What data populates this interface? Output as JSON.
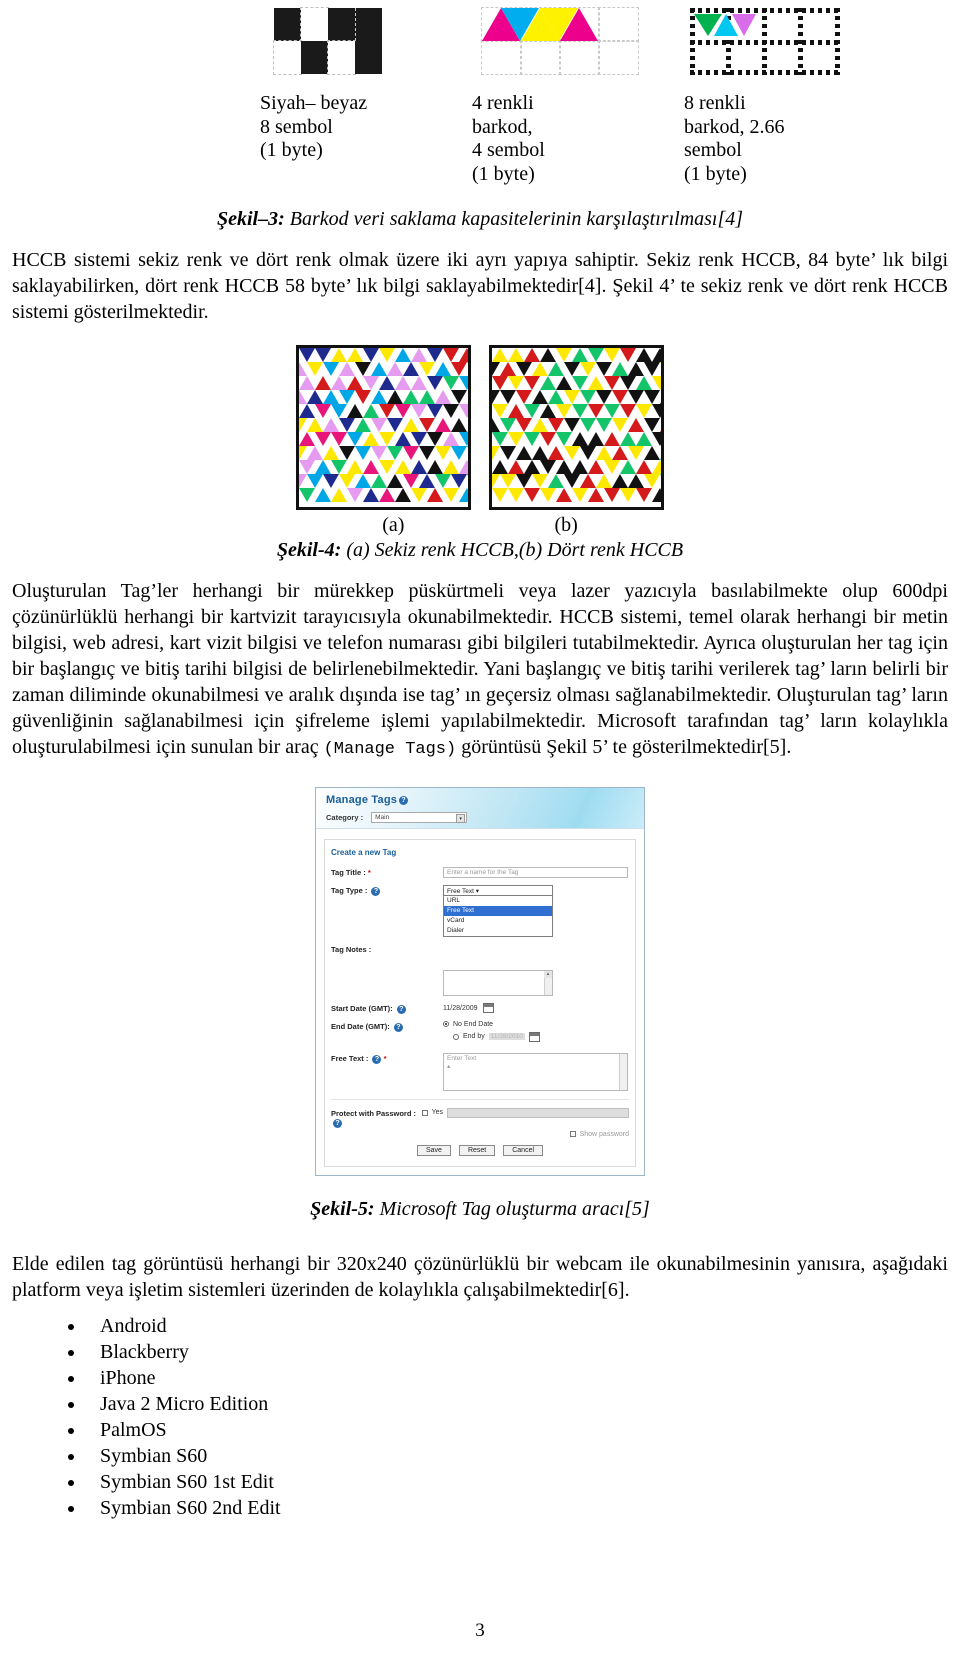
{
  "figure3": {
    "samples": [
      {
        "label_lines": [
          "Siyah– beyaz",
          "8 sembol",
          "(1 byte)"
        ],
        "icon": "bw-barcode-icon"
      },
      {
        "label_lines": [
          "4 renkli",
          "barkod,",
          "4 sembol",
          "(1 byte)"
        ],
        "icon": "four-color-barcode-icon"
      },
      {
        "label_lines": [
          "8 renkli",
          "barkod, 2.66",
          "sembol",
          "(1 byte)"
        ],
        "icon": "eight-color-barcode-icon"
      }
    ],
    "caption_label": "Şekil–3:",
    "caption_text": "Barkod veri saklama kapasitelerinin karşılaştırılması[4]"
  },
  "paragraph1": "HCCB sistemi sekiz renk ve dört renk olmak üzere iki ayrı yapıya sahiptir. Sekiz renk HCCB, 84 byte’ lık bilgi saklayabilirken, dört renk HCCB 58 byte’ lık bilgi saklayabilmektedir[4]. Şekil 4’ te sekiz renk ve dört renk HCCB sistemi gösterilmektedir.",
  "figure4": {
    "sub_a": "(a)",
    "sub_b": "(b)",
    "caption_label": "Şekil-4:",
    "caption_text": "(a) Sekiz renk HCCB,(b) Dört renk HCCB",
    "eight_color_palette": [
      "#e8157a",
      "#00a7e6",
      "#14c46a",
      "#ffe800",
      "#1f2a8f",
      "#d41a1a",
      "#111111",
      "#e49bf0"
    ],
    "four_color_palette": [
      "#ffe800",
      "#14c46a",
      "#d41a1a",
      "#111111"
    ]
  },
  "paragraph2_part1": "Oluşturulan Tag’ler herhangi bir mürekkep püskürtmeli veya lazer yazıcıyla basılabilmekte olup 600dpi çözünürlüklü herhangi bir kartvizit tarayıcısıyla okunabilmektedir. HCCB sistemi, temel olarak herhangi bir metin bilgisi, web adresi, kart vizit bilgisi ve telefon numarası gibi bilgileri tutabilmektedir. Ayrıca oluşturulan her tag için bir başlangıç ve bitiş tarihi bilgisi de belirlenebilmektedir. Yani başlangıç ve bitiş tarihi verilerek tag’ ların belirli bir zaman diliminde okunabilmesi ve aralık dışında ise tag’ ın geçersiz olması sağlanabilmektedir. Oluşturulan tag’ ların güvenliğinin sağlanabilmesi için şifreleme işlemi yapılabilmektedir. Microsoft tarafından tag’ ların kolaylıkla oluşturulabilmesi için sunulan bir araç ",
  "paragraph2_mono": "(Manage Tags)",
  "paragraph2_part2": " görüntüsü Şekil 5’ te gösterilmektedir[5].",
  "manage_tags": {
    "title": "Manage Tags",
    "help_icon": "help-icon",
    "category_label": "Category :",
    "category_value": "Main",
    "create_new": "Create a new Tag",
    "tag_title_label": "Tag Title :",
    "tag_title_placeholder": "Enter a name for the Tag",
    "tag_type_label": "Tag Type :",
    "tag_type_value": "Free Text",
    "tag_type_options": [
      "URL",
      "Free Text",
      "vCard",
      "Dialer"
    ],
    "tag_type_selected": "Free Text",
    "tag_notes_label": "Tag Notes :",
    "start_date_label": "Start Date (GMT):",
    "start_date_value": "11/28/2009",
    "end_date_label": "End Date (GMT):",
    "no_end_date_label": "No End Date",
    "end_by_label": "End by",
    "end_by_value": "11/28/2010",
    "free_text_label": "Free Text :",
    "free_text_placeholder": "Enter Text",
    "protect_label": "Protect with Password :",
    "yes_label": "Yes",
    "show_password_label": "Show password",
    "buttons": [
      "Save",
      "Reset",
      "Cancel"
    ],
    "required_mark": "*",
    "accent_color": "#19609b",
    "select_highlight": "#2f6fd0"
  },
  "figure5": {
    "caption_label": "Şekil-5:",
    "caption_text": "Microsoft Tag oluşturma aracı[5]"
  },
  "paragraph3": "Elde edilen tag görüntüsü herhangi bir 320x240 çözünürlüklü bir webcam ile okunabilmesinin yanısıra, aşağıdaki platform veya işletim sistemleri üzerinden de kolaylıkla çalışabilmektedir[6].",
  "platforms": [
    "Android",
    "Blackberry",
    "iPhone",
    "Java 2 Micro Edition",
    "PalmOS",
    "Symbian S60",
    "Symbian S60 1st Edit",
    "Symbian S60 2nd Edit"
  ],
  "page_number": "3"
}
